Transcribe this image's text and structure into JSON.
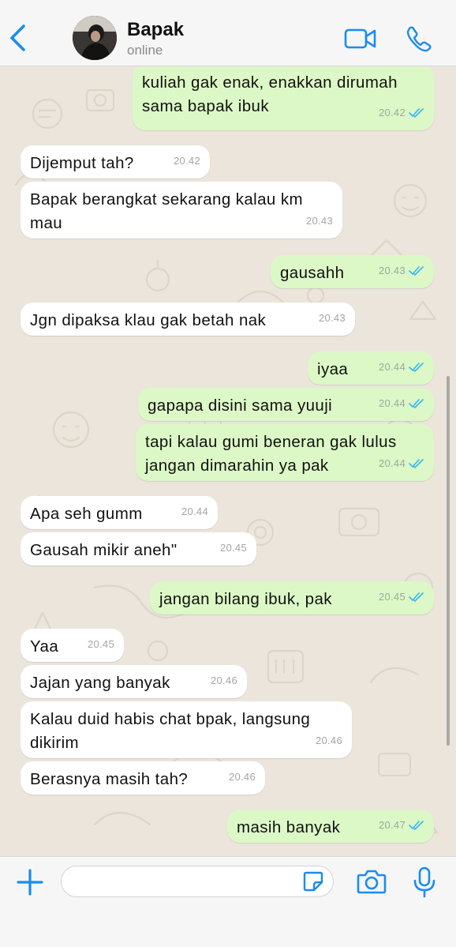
{
  "header": {
    "name": "Bapak",
    "status": "online",
    "icons": {
      "back": "chevron-left-icon",
      "video": "video-call-icon",
      "call": "phone-icon"
    }
  },
  "colors": {
    "accent": "#1a8cf0",
    "incoming": "#ffffff",
    "outgoing": "#dcf8c6",
    "wallpaper": "#ebe5dc",
    "read_ticks": "#34b7f1"
  },
  "messages": [
    {
      "dir": "out",
      "text": "kuliah gak enak, enakkan dirumah sama bapak ibuk",
      "time": "20.42"
    },
    {
      "dir": "in",
      "text": "Dijemput tah?",
      "time": "20.42"
    },
    {
      "dir": "in",
      "text": "Bapak berangkat sekarang kalau km mau",
      "time": "20.43"
    },
    {
      "dir": "out",
      "text": "gausahh",
      "time": "20.43"
    },
    {
      "dir": "in",
      "text": "Jgn dipaksa klau gak betah nak",
      "time": "20.43"
    },
    {
      "dir": "out",
      "text": "iyaa",
      "time": "20.44"
    },
    {
      "dir": "out",
      "text": "gapapa disini sama yuuji",
      "time": "20.44"
    },
    {
      "dir": "out",
      "text": "tapi kalau gumi beneran gak lulus jangan dimarahin ya pak",
      "time": "20.44"
    },
    {
      "dir": "in",
      "text": "Apa seh gumm",
      "time": "20.44"
    },
    {
      "dir": "in",
      "text": "Gausah mikir aneh\"",
      "time": "20.45"
    },
    {
      "dir": "out",
      "text": "jangan bilang ibuk, pak",
      "time": "20.45"
    },
    {
      "dir": "in",
      "text": "Yaa",
      "time": "20.45"
    },
    {
      "dir": "in",
      "text": "Jajan yang banyak",
      "time": "20.46"
    },
    {
      "dir": "in",
      "text": "Kalau duid habis chat bpak, langsung dikirim",
      "time": "20.46"
    },
    {
      "dir": "in",
      "text": "Berasnya masih tah?",
      "time": "20.46"
    },
    {
      "dir": "out",
      "text": "masih banyak",
      "time": "20.47"
    }
  ],
  "composer": {
    "value": "",
    "placeholder": "",
    "icons": {
      "attach": "plus-icon",
      "sticker": "sticker-icon",
      "camera": "camera-icon",
      "mic": "microphone-icon"
    }
  }
}
